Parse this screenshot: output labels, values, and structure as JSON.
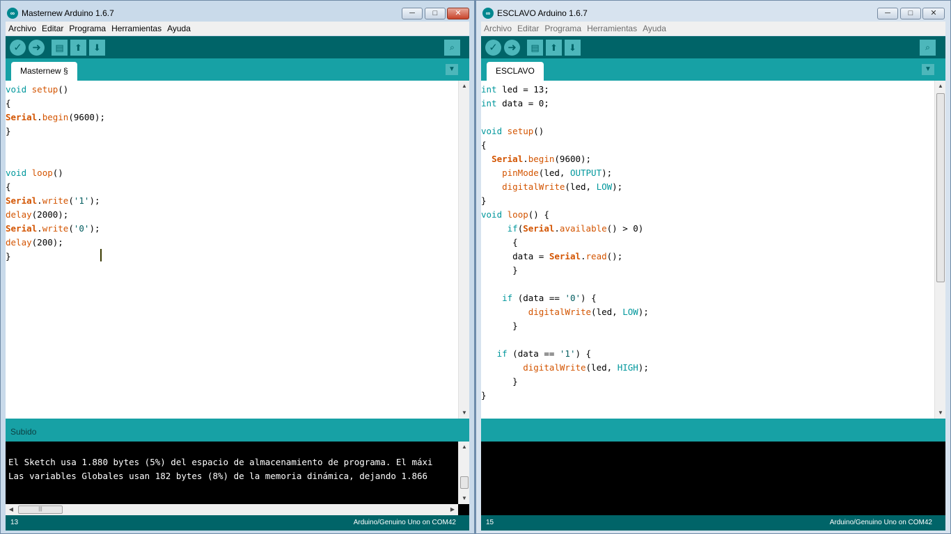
{
  "left": {
    "title": "Masternew Arduino 1.6.7",
    "menu": [
      "Archivo",
      "Editar",
      "Programa",
      "Herramientas",
      "Ayuda"
    ],
    "tab": "Masternew §",
    "code": [
      [
        {
          "t": "void",
          "c": "kw"
        },
        {
          "t": " "
        },
        {
          "t": "setup",
          "c": "fn"
        },
        {
          "t": "()"
        }
      ],
      [
        {
          "t": "{"
        }
      ],
      [
        {
          "t": "Serial",
          "c": "cls"
        },
        {
          "t": "."
        },
        {
          "t": "begin",
          "c": "fn"
        },
        {
          "t": "(9600);"
        }
      ],
      [
        {
          "t": "}"
        }
      ],
      [],
      [],
      [
        {
          "t": "void",
          "c": "kw"
        },
        {
          "t": " "
        },
        {
          "t": "loop",
          "c": "fn"
        },
        {
          "t": "()"
        }
      ],
      [
        {
          "t": "{"
        }
      ],
      [
        {
          "t": "Serial",
          "c": "cls"
        },
        {
          "t": "."
        },
        {
          "t": "write",
          "c": "fn"
        },
        {
          "t": "("
        },
        {
          "t": "'1'",
          "c": "str"
        },
        {
          "t": ");"
        }
      ],
      [
        {
          "t": "delay",
          "c": "fn"
        },
        {
          "t": "(2000);"
        }
      ],
      [
        {
          "t": "Serial",
          "c": "cls"
        },
        {
          "t": "."
        },
        {
          "t": "write",
          "c": "fn"
        },
        {
          "t": "("
        },
        {
          "t": "'0'",
          "c": "str"
        },
        {
          "t": ");"
        }
      ],
      [
        {
          "t": "delay",
          "c": "fn"
        },
        {
          "t": "(200);"
        }
      ],
      [
        {
          "t": "}"
        }
      ]
    ],
    "status_message": "Subido",
    "console": [
      "",
      "El Sketch usa 1.880 bytes (5%) del espacio de almacenamiento de programa. El máxi",
      "Las variables Globales usan 182 bytes (8%) de la memoria dinámica, dejando 1.866 "
    ],
    "line_number": "13",
    "board": "Arduino/Genuino Uno on COM42"
  },
  "right": {
    "title": "ESCLAVO Arduino 1.6.7",
    "menu": [
      "Archivo",
      "Editar",
      "Programa",
      "Herramientas",
      "Ayuda"
    ],
    "tab": "ESCLAVO",
    "code": [
      [
        {
          "t": "int",
          "c": "kw"
        },
        {
          "t": " led = 13;"
        }
      ],
      [
        {
          "t": "int",
          "c": "kw"
        },
        {
          "t": " data = 0;"
        }
      ],
      [],
      [
        {
          "t": "void",
          "c": "kw"
        },
        {
          "t": " "
        },
        {
          "t": "setup",
          "c": "fn"
        },
        {
          "t": "()"
        }
      ],
      [
        {
          "t": "{"
        }
      ],
      [
        {
          "t": "  "
        },
        {
          "t": "Serial",
          "c": "cls"
        },
        {
          "t": "."
        },
        {
          "t": "begin",
          "c": "fn"
        },
        {
          "t": "(9600);"
        }
      ],
      [
        {
          "t": "    "
        },
        {
          "t": "pinMode",
          "c": "fn"
        },
        {
          "t": "(led, "
        },
        {
          "t": "OUTPUT",
          "c": "const"
        },
        {
          "t": ");"
        }
      ],
      [
        {
          "t": "    "
        },
        {
          "t": "digitalWrite",
          "c": "fn"
        },
        {
          "t": "(led, "
        },
        {
          "t": "LOW",
          "c": "const"
        },
        {
          "t": ");"
        }
      ],
      [
        {
          "t": "}"
        }
      ],
      [
        {
          "t": "void",
          "c": "kw"
        },
        {
          "t": " "
        },
        {
          "t": "loop",
          "c": "fn"
        },
        {
          "t": "() {"
        }
      ],
      [
        {
          "t": "     "
        },
        {
          "t": "if",
          "c": "kw"
        },
        {
          "t": "("
        },
        {
          "t": "Serial",
          "c": "cls"
        },
        {
          "t": "."
        },
        {
          "t": "available",
          "c": "fn"
        },
        {
          "t": "() > 0)"
        }
      ],
      [
        {
          "t": "      {"
        }
      ],
      [
        {
          "t": "      data = "
        },
        {
          "t": "Serial",
          "c": "cls"
        },
        {
          "t": "."
        },
        {
          "t": "read",
          "c": "fn"
        },
        {
          "t": "();"
        }
      ],
      [
        {
          "t": "      }"
        }
      ],
      [],
      [
        {
          "t": "    "
        },
        {
          "t": "if",
          "c": "kw"
        },
        {
          "t": " (data == "
        },
        {
          "t": "'0'",
          "c": "str"
        },
        {
          "t": ") {"
        }
      ],
      [
        {
          "t": "         "
        },
        {
          "t": "digitalWrite",
          "c": "fn"
        },
        {
          "t": "(led, "
        },
        {
          "t": "LOW",
          "c": "const"
        },
        {
          "t": ");"
        }
      ],
      [
        {
          "t": "      }"
        }
      ],
      [],
      [
        {
          "t": "   "
        },
        {
          "t": "if",
          "c": "kw"
        },
        {
          "t": " (data == "
        },
        {
          "t": "'1'",
          "c": "str"
        },
        {
          "t": ") {"
        }
      ],
      [
        {
          "t": "        "
        },
        {
          "t": "digitalWrite",
          "c": "fn"
        },
        {
          "t": "(led, "
        },
        {
          "t": "HIGH",
          "c": "const"
        },
        {
          "t": ");"
        }
      ],
      [
        {
          "t": "      }"
        }
      ],
      [
        {
          "t": "}"
        }
      ]
    ],
    "status_message": "",
    "line_number": "15",
    "board": "Arduino/Genuino Uno on COM42"
  },
  "window_buttons": {
    "minimize": "─",
    "maximize": "□",
    "close": "✕"
  },
  "icons": {
    "verify": "check-icon",
    "upload": "arrow-right-icon",
    "new": "new-file-icon",
    "open": "arrow-up-icon",
    "save": "arrow-down-icon",
    "serial_monitor": "magnifier-icon",
    "tab_menu": "chevron-down-icon"
  },
  "colors": {
    "toolbar": "#006468",
    "accent": "#17a1a5",
    "keyword": "#00979c",
    "function": "#d35400"
  }
}
